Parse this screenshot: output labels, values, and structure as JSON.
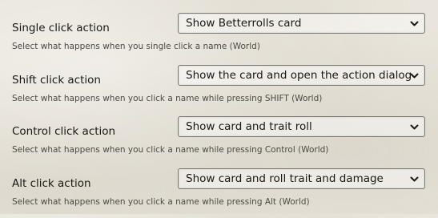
{
  "settings": [
    {
      "label": "Single click action",
      "value": "Show Betterrolls card",
      "hint": "Select what happens when you single click a name (World)"
    },
    {
      "label": "Shift click action",
      "value": "Show the card and open the action dialog",
      "hint": "Select what happens when you click a name while pressing SHIFT (World)"
    },
    {
      "label": "Control click action",
      "value": "Show card and trait roll",
      "hint": "Select what happens when you click a name while pressing Control (World)"
    },
    {
      "label": "Alt click action",
      "value": "Show card and roll trait and damage",
      "hint": "Select what happens when you click a name while pressing Alt (World)"
    }
  ],
  "icons": {
    "dropdown": "chevron-down-icon"
  },
  "colors": {
    "background": "#e9e5dc",
    "text": "#191813",
    "hint_text": "#4b4a44",
    "select_border": "#7a7971"
  }
}
